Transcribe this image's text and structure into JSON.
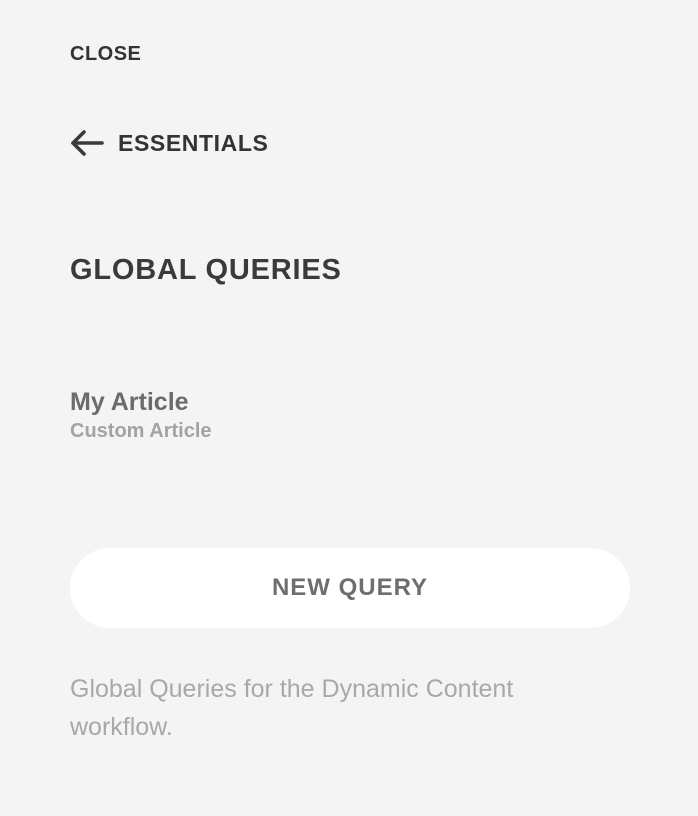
{
  "nav": {
    "close_label": "CLOSE",
    "back_label": "ESSENTIALS",
    "back_icon": "arrow-left-icon"
  },
  "page": {
    "title": "GLOBAL QUERIES"
  },
  "queries": [
    {
      "name": "My Article",
      "type": "Custom Article"
    }
  ],
  "actions": {
    "new_query_label": "NEW QUERY"
  },
  "footer": {
    "description": "Global Queries for the Dynamic Content workflow."
  },
  "colors": {
    "background": "#f4f4f4",
    "button_background": "#ffffff",
    "heading_text": "#3a3a3a",
    "muted_text": "#a8a8a8"
  }
}
